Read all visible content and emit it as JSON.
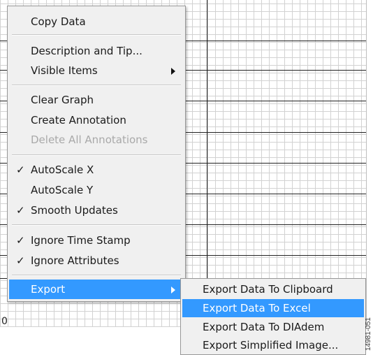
{
  "menu": {
    "items": [
      {
        "label": "Copy Data"
      },
      {
        "label": "Description and Tip..."
      },
      {
        "label": "Visible Items"
      },
      {
        "label": "Clear Graph"
      },
      {
        "label": "Create Annotation"
      },
      {
        "label": "Delete All Annotations"
      },
      {
        "label": "AutoScale X",
        "check": "✓"
      },
      {
        "label": "AutoScale Y"
      },
      {
        "label": "Smooth Updates",
        "check": "✓"
      },
      {
        "label": "Ignore Time Stamp",
        "check": "✓"
      },
      {
        "label": "Ignore Attributes",
        "check": "✓"
      },
      {
        "label": "Export"
      }
    ]
  },
  "export_submenu": {
    "items": [
      {
        "label": "Export Data To Clipboard"
      },
      {
        "label": "Export Data To Excel"
      },
      {
        "label": "Export Data To DIAdem"
      },
      {
        "label": "Export Simplified Image..."
      }
    ]
  },
  "graph": {
    "axis_tick_label": "0"
  },
  "figure_id": "14981-051",
  "colors": {
    "highlight": "#3399ff",
    "menu_background": "#f0f0f0",
    "grid_minor": "#d2d2d2",
    "grid_major": "#222222"
  }
}
